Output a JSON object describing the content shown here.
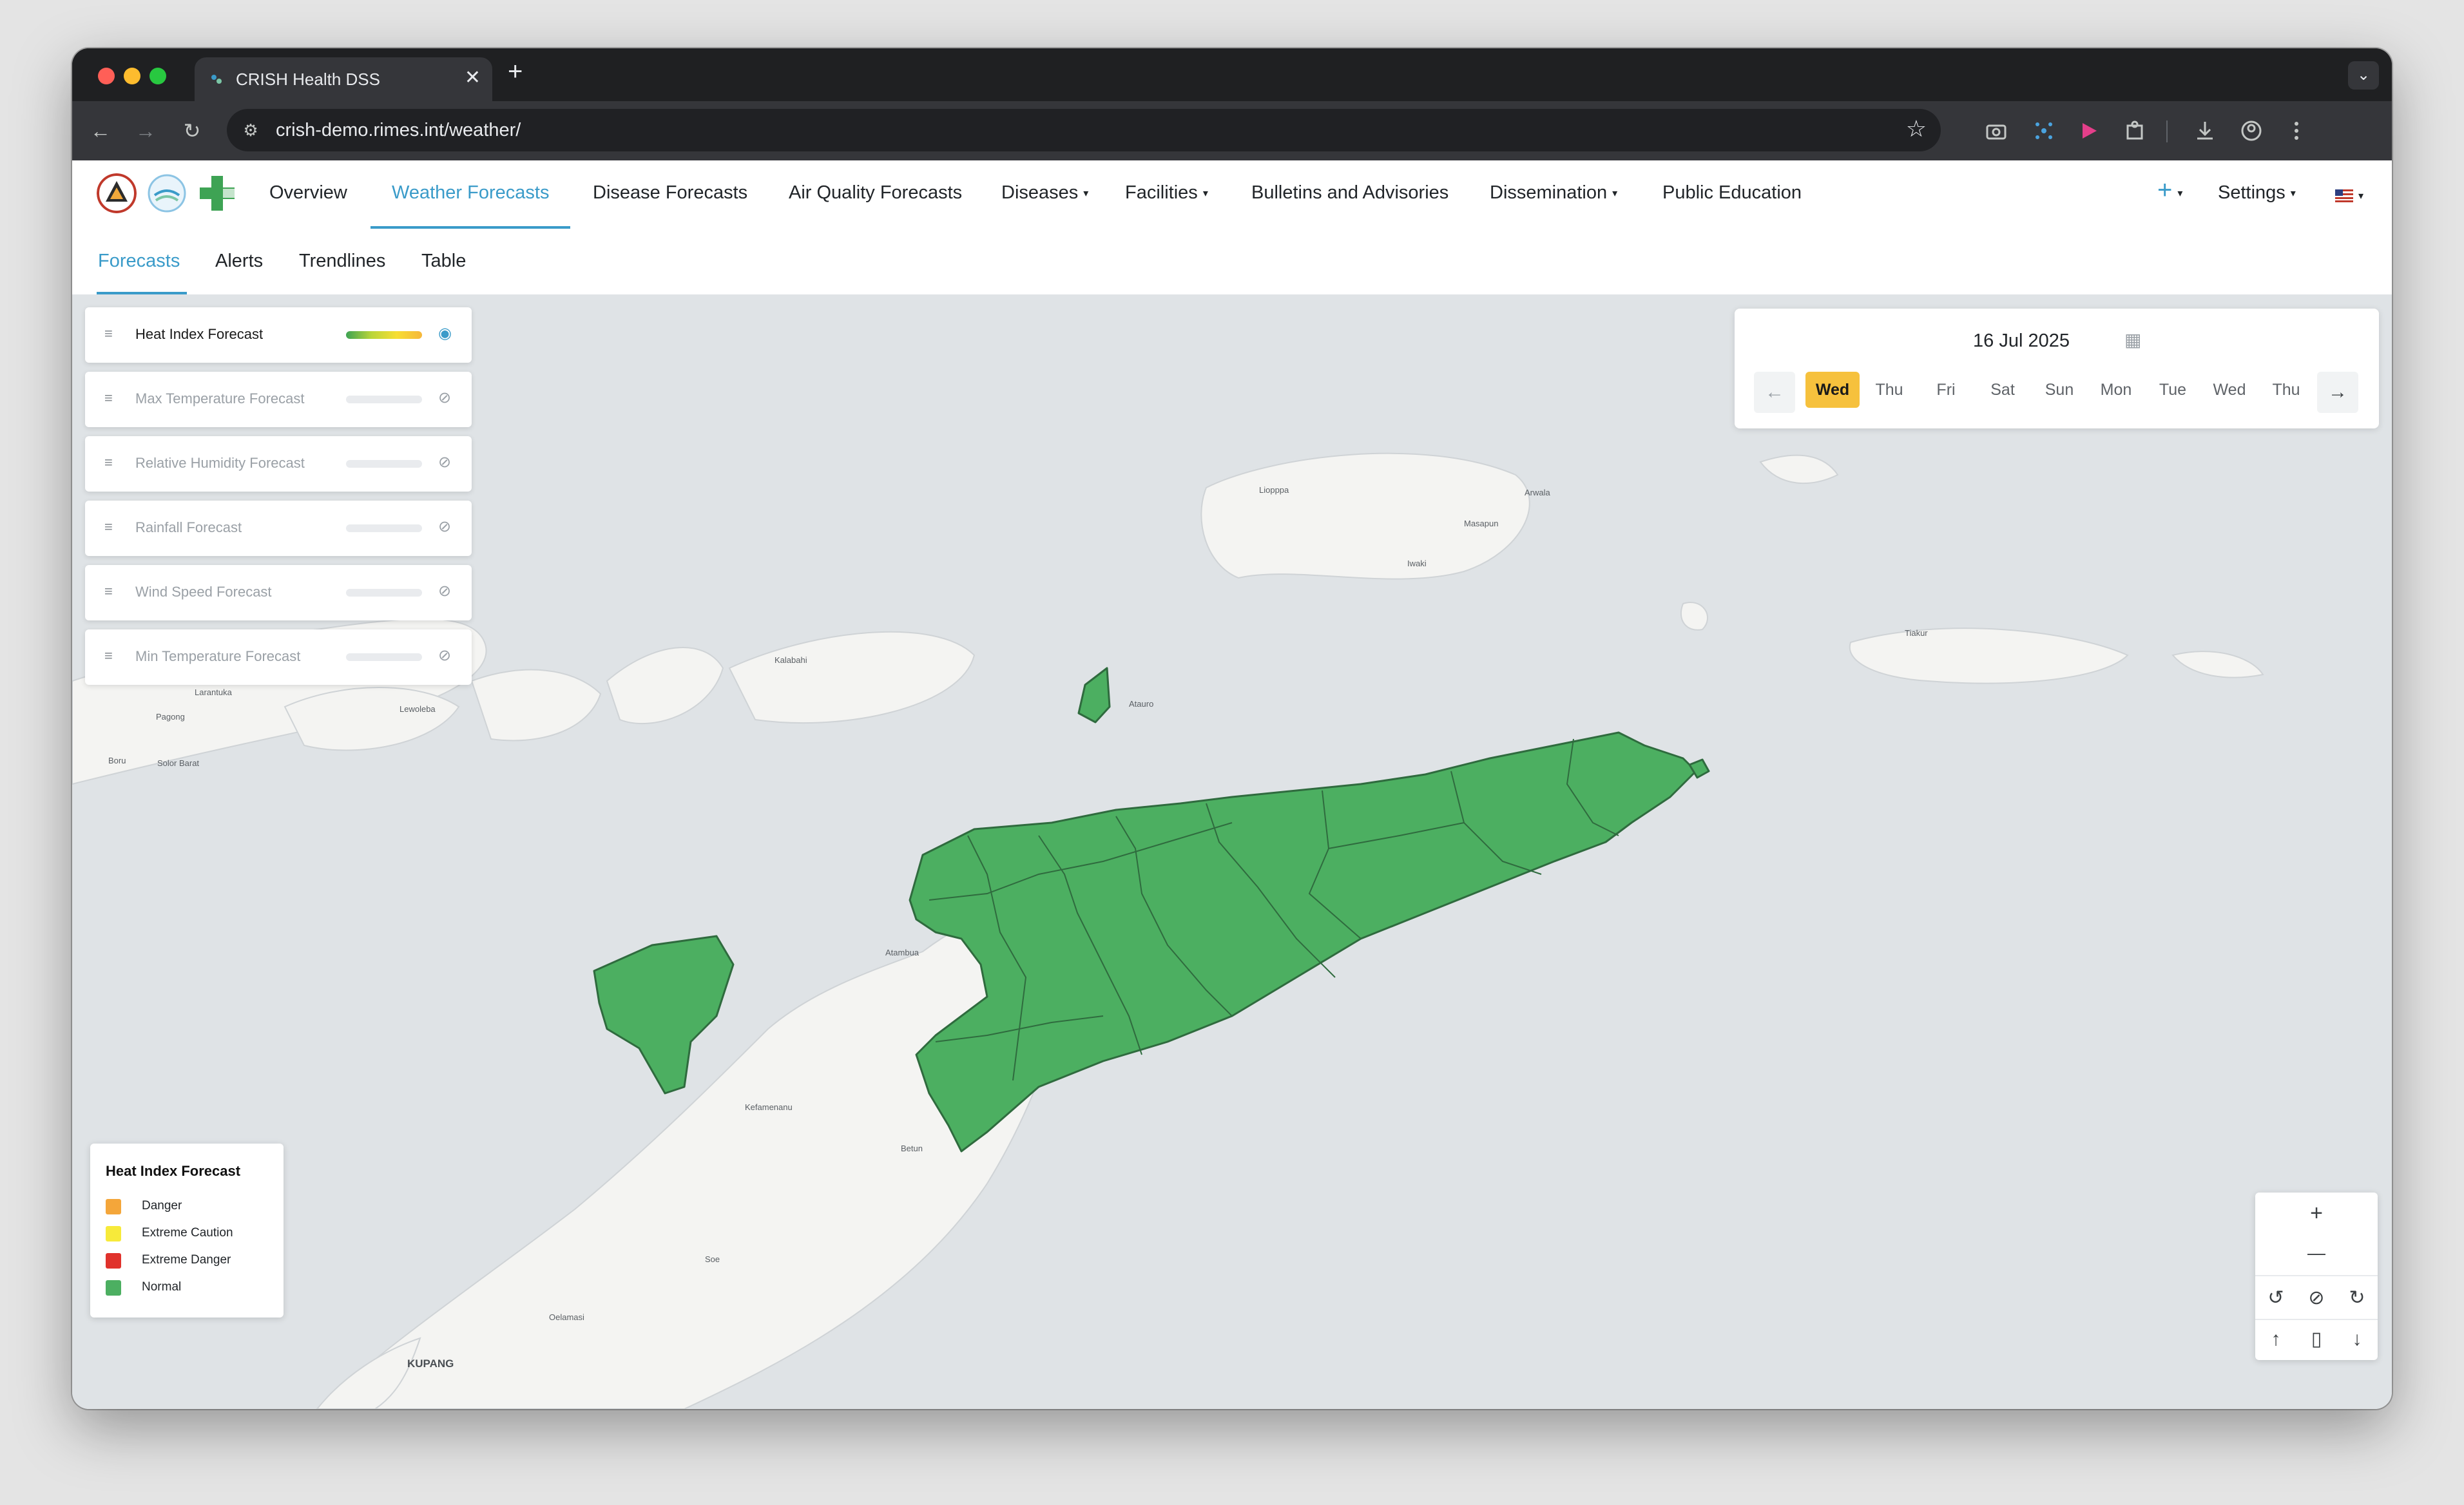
{
  "browser": {
    "tab_title": "CRISH Health DSS",
    "tab_close": "✕",
    "new_tab": "+",
    "tab_menu": "⌄",
    "url": "crish-demo.rimes.int/weather/",
    "back": "←",
    "forward": "→",
    "reload": "↻",
    "bookmark": "☆"
  },
  "navbar": {
    "items": [
      {
        "label": "Overview"
      },
      {
        "label": "Weather Forecasts",
        "active": true
      },
      {
        "label": "Disease Forecasts"
      },
      {
        "label": "Air Quality Forecasts"
      },
      {
        "label": "Diseases",
        "dropdown": true
      },
      {
        "label": "Facilities",
        "dropdown": true
      },
      {
        "label": "Bulletins and Advisories"
      },
      {
        "label": "Dissemination",
        "dropdown": true
      },
      {
        "label": "Public Education"
      }
    ],
    "add": "+",
    "settings": "Settings",
    "caret": "▾"
  },
  "subnav": {
    "items": [
      {
        "label": "Forecasts",
        "active": true
      },
      {
        "label": "Alerts"
      },
      {
        "label": "Trendlines"
      },
      {
        "label": "Table"
      }
    ]
  },
  "layers": [
    {
      "name": "Heat Index Forecast",
      "visible": true
    },
    {
      "name": "Max Temperature Forecast",
      "visible": false
    },
    {
      "name": "Relative Humidity Forecast",
      "visible": false
    },
    {
      "name": "Rainfall Forecast",
      "visible": false
    },
    {
      "name": "Wind Speed Forecast",
      "visible": false
    },
    {
      "name": "Min Temperature Forecast",
      "visible": false
    }
  ],
  "date_picker": {
    "date": "16 Jul 2025",
    "days": [
      "Wed",
      "Thu",
      "Fri",
      "Sat",
      "Sun",
      "Mon",
      "Tue",
      "Wed",
      "Thu"
    ],
    "active_day": "Wed",
    "prev": "←",
    "next": "→"
  },
  "legend": {
    "title": "Heat Index Forecast",
    "items": [
      {
        "label": "Danger",
        "color": "#f4a63a"
      },
      {
        "label": "Extreme Caution",
        "color": "#f7ea3a"
      },
      {
        "label": "Extreme Danger",
        "color": "#e0322c"
      },
      {
        "label": "Normal",
        "color": "#4caf61"
      }
    ]
  },
  "map_labels": [
    "Liopppa",
    "Arwala",
    "Masapun",
    "Iwaki",
    "Kalabahi",
    "Larantuka",
    "Pagong",
    "Lewoleba",
    "Boru",
    "Solor Barat",
    "Atambua",
    "Kefamenanu",
    "Betun",
    "Soe",
    "Oelamasi",
    "KUPANG",
    "Tiakur",
    "Atauro"
  ],
  "map_controls": {
    "zoom_in": "+",
    "zoom_out": "—",
    "rotate_left": "↺",
    "compass": "⊘",
    "rotate_right": "↻",
    "up": "↑",
    "page": "▯",
    "down": "↓"
  },
  "colors": {
    "accent": "#3a9bc9",
    "region_fill": "#4caf61",
    "sea": "#dfe3e6",
    "land": "#f4f4f2"
  }
}
